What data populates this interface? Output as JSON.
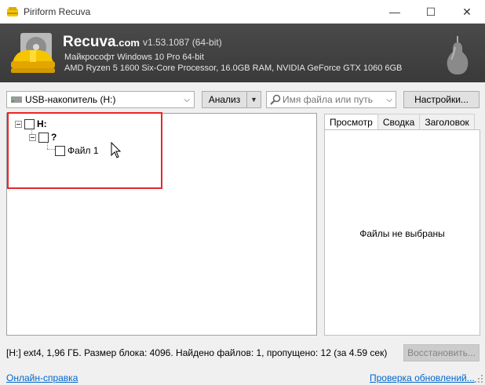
{
  "window": {
    "title": "Piriform Recuva",
    "minimize": "—",
    "maximize": "☐",
    "close": "✕"
  },
  "banner": {
    "brand": "Recuva",
    "brand_suffix": ".com",
    "version": "v1.53.1087 (64-bit)",
    "os_line": "Майкрософт Windows 10 Pro 64-bit",
    "hw_line": "AMD Ryzen 5 1600 Six-Core Processor, 16.0GB RAM, NVIDIA GeForce GTX 1060 6GB"
  },
  "toolbar": {
    "drive": "USB-накопитель (H:)",
    "scan_label": "Анализ",
    "search_placeholder": "Имя файла или путь",
    "settings_label": "Настройки..."
  },
  "tree": {
    "root": "H:",
    "folder": "?",
    "file": "Файл 1"
  },
  "tabs": [
    {
      "label": "Просмотр",
      "active": true
    },
    {
      "label": "Сводка",
      "active": false
    },
    {
      "label": "Заголовок",
      "active": false
    }
  ],
  "preview": {
    "empty_text": "Файлы не выбраны"
  },
  "status": {
    "text": "[H:] ext4, 1,96 ГБ. Размер блока: 4096. Найдено файлов: 1, пропущено: 12 (за 4.59 сек)",
    "recover_label": "Восстановить..."
  },
  "footer": {
    "help_link": "Онлайн-справка",
    "update_link": "Проверка обновлений..."
  },
  "colors": {
    "banner_bg": "#3f3f3f",
    "highlight": "#e8262a",
    "link": "#0066cc"
  }
}
